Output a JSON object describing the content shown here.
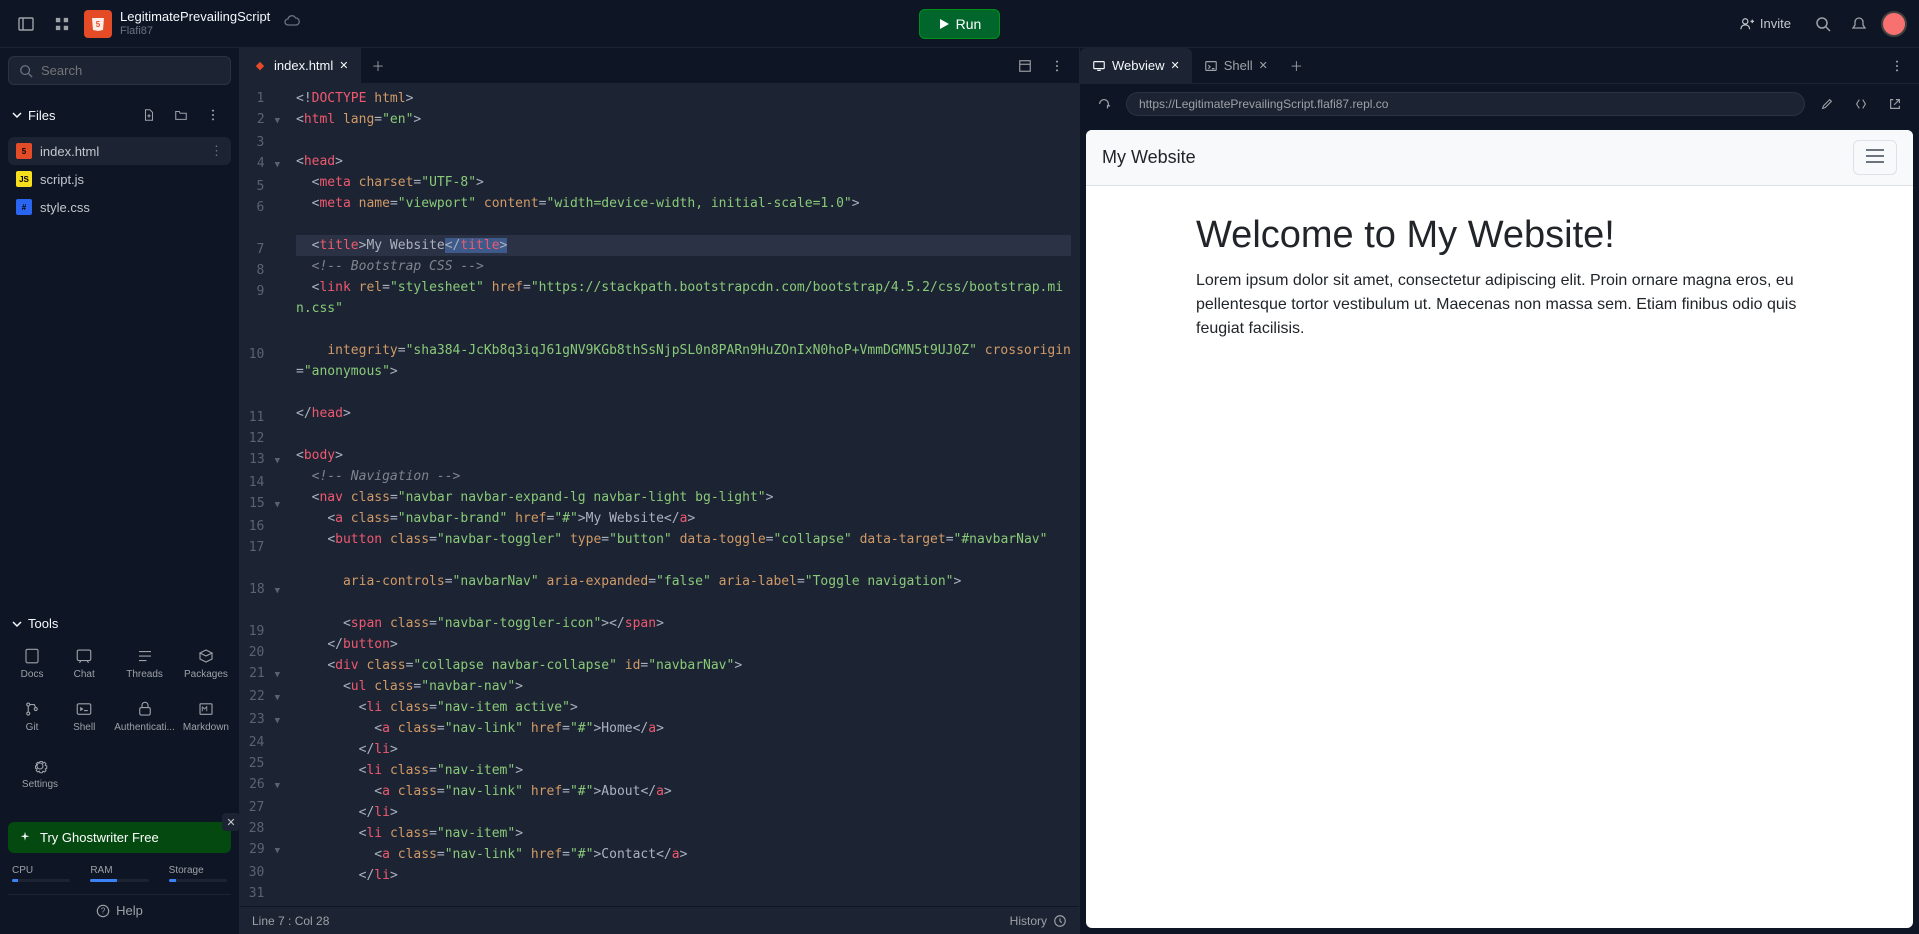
{
  "project": {
    "title": "LegitimatePrevailingScript",
    "owner": "Flafi87"
  },
  "topbar": {
    "run": "Run",
    "invite": "Invite"
  },
  "search": {
    "placeholder": "Search"
  },
  "files": {
    "header": "Files",
    "items": [
      {
        "name": "index.html",
        "type": "html",
        "active": true
      },
      {
        "name": "script.js",
        "type": "js"
      },
      {
        "name": "style.css",
        "type": "css"
      }
    ]
  },
  "tools": {
    "header": "Tools",
    "items": [
      "Docs",
      "Chat",
      "Threads",
      "Packages",
      "Git",
      "Shell",
      "Authenticati...",
      "Markdown"
    ],
    "settings": "Settings"
  },
  "ghostwriter": "Try Ghostwriter Free",
  "stats": {
    "cpu": "CPU",
    "ram": "RAM",
    "storage": "Storage",
    "cpu_pct": 10,
    "ram_pct": 45,
    "storage_pct": 12
  },
  "help": "Help",
  "editor": {
    "tab": "index.html",
    "status_left": "Line 7 : Col 28",
    "status_right": "History"
  },
  "code_lines": [
    {
      "n": 1,
      "html": "<span class='t-punc'>&lt;!</span><span class='t-tag'>DOCTYPE</span> <span class='t-attr'>html</span><span class='t-punc'>&gt;</span>"
    },
    {
      "n": 2,
      "fold": true,
      "html": "<span class='t-punc'>&lt;</span><span class='t-tag'>html</span> <span class='t-attr'>lang</span><span class='t-punc'>=</span><span class='t-str'>\"en\"</span><span class='t-punc'>&gt;</span>"
    },
    {
      "n": 3,
      "html": ""
    },
    {
      "n": 4,
      "fold": true,
      "html": "<span class='t-punc'>&lt;</span><span class='t-tag'>head</span><span class='t-punc'>&gt;</span>"
    },
    {
      "n": 5,
      "html": "  <span class='t-punc'>&lt;</span><span class='t-tag'>meta</span> <span class='t-attr'>charset</span><span class='t-punc'>=</span><span class='t-str'>\"UTF-8\"</span><span class='t-punc'>&gt;</span>"
    },
    {
      "n": 6,
      "html": "  <span class='t-punc'>&lt;</span><span class='t-tag'>meta</span> <span class='t-attr'>name</span><span class='t-punc'>=</span><span class='t-str'>\"viewport\"</span> <span class='t-attr'>content</span><span class='t-punc'>=</span><span class='t-str'>\"width=device-width, initial-scale=1.0\"</span><span class='t-punc'>&gt;</span>"
    },
    {
      "n": 7,
      "hl": true,
      "html": "  <span class='t-punc'>&lt;</span><span class='t-tag'>title</span><span class='t-punc'>&gt;</span><span class='t-text'>My Website</span><span class='sel'><span class='t-punc'>&lt;/</span><span class='t-tag'>title</span><span class='t-punc'>&gt;</span></span>"
    },
    {
      "n": 8,
      "html": "  <span class='t-comment'>&lt;!-- Bootstrap CSS --&gt;</span>"
    },
    {
      "n": 9,
      "html": "  <span class='t-punc'>&lt;</span><span class='t-tag'>link</span> <span class='t-attr'>rel</span><span class='t-punc'>=</span><span class='t-str'>\"stylesheet\"</span> <span class='t-attr'>href</span><span class='t-punc'>=</span><span class='t-str'>\"https://stackpath.bootstrapcdn.com/bootstrap/4.5.2/css/bootstrap.min.css\"</span>"
    },
    {
      "n": 10,
      "html": "    <span class='t-attr'>integrity</span><span class='t-punc'>=</span><span class='t-str'>\"sha384-JcKb8q3iqJ61gNV9KGb8thSsNjpSL0n8PARn9HuZOnIxN0hoP+VmmDGMN5t9UJ0Z\"</span> <span class='t-attr'>crossorigin</span><span class='t-punc'>=</span><span class='t-str'>\"anonymous\"</span><span class='t-punc'>&gt;</span>"
    },
    {
      "n": 11,
      "html": "<span class='t-punc'>&lt;/</span><span class='t-tag'>head</span><span class='t-punc'>&gt;</span>"
    },
    {
      "n": 12,
      "html": ""
    },
    {
      "n": 13,
      "fold": true,
      "html": "<span class='t-punc'>&lt;</span><span class='t-tag'>body</span><span class='t-punc'>&gt;</span>"
    },
    {
      "n": 14,
      "html": "  <span class='t-comment'>&lt;!-- Navigation --&gt;</span>"
    },
    {
      "n": 15,
      "fold": true,
      "html": "  <span class='t-punc'>&lt;</span><span class='t-tag'>nav</span> <span class='t-attr'>class</span><span class='t-punc'>=</span><span class='t-str'>\"navbar navbar-expand-lg navbar-light bg-light\"</span><span class='t-punc'>&gt;</span>"
    },
    {
      "n": 16,
      "html": "    <span class='t-punc'>&lt;</span><span class='t-tag'>a</span> <span class='t-attr'>class</span><span class='t-punc'>=</span><span class='t-str'>\"navbar-brand\"</span> <span class='t-attr'>href</span><span class='t-punc'>=</span><span class='t-str'>\"#\"</span><span class='t-punc'>&gt;</span><span class='t-text'>My Website</span><span class='t-punc'>&lt;/</span><span class='t-tag'>a</span><span class='t-punc'>&gt;</span>"
    },
    {
      "n": 17,
      "html": "    <span class='t-punc'>&lt;</span><span class='t-tag'>button</span> <span class='t-attr'>class</span><span class='t-punc'>=</span><span class='t-str'>\"navbar-toggler\"</span> <span class='t-attr'>type</span><span class='t-punc'>=</span><span class='t-str'>\"button\"</span> <span class='t-attr'>data-toggle</span><span class='t-punc'>=</span><span class='t-str'>\"collapse\"</span> <span class='t-attr'>data-target</span><span class='t-punc'>=</span><span class='t-str'>\"#navbarNav\"</span>"
    },
    {
      "n": 18,
      "fold": true,
      "html": "      <span class='t-attr'>aria-controls</span><span class='t-punc'>=</span><span class='t-str'>\"navbarNav\"</span> <span class='t-attr'>aria-expanded</span><span class='t-punc'>=</span><span class='t-str'>\"false\"</span> <span class='t-attr'>aria-label</span><span class='t-punc'>=</span><span class='t-str'>\"Toggle navigation\"</span><span class='t-punc'>&gt;</span>"
    },
    {
      "n": 19,
      "html": "      <span class='t-punc'>&lt;</span><span class='t-tag'>span</span> <span class='t-attr'>class</span><span class='t-punc'>=</span><span class='t-str'>\"navbar-toggler-icon\"</span><span class='t-punc'>&gt;&lt;/</span><span class='t-tag'>span</span><span class='t-punc'>&gt;</span>"
    },
    {
      "n": 20,
      "html": "    <span class='t-punc'>&lt;/</span><span class='t-tag'>button</span><span class='t-punc'>&gt;</span>"
    },
    {
      "n": 21,
      "fold": true,
      "html": "    <span class='t-punc'>&lt;</span><span class='t-tag'>div</span> <span class='t-attr'>class</span><span class='t-punc'>=</span><span class='t-str'>\"collapse navbar-collapse\"</span> <span class='t-attr'>id</span><span class='t-punc'>=</span><span class='t-str'>\"navbarNav\"</span><span class='t-punc'>&gt;</span>"
    },
    {
      "n": 22,
      "fold": true,
      "html": "      <span class='t-punc'>&lt;</span><span class='t-tag'>ul</span> <span class='t-attr'>class</span><span class='t-punc'>=</span><span class='t-str'>\"navbar-nav\"</span><span class='t-punc'>&gt;</span>"
    },
    {
      "n": 23,
      "fold": true,
      "html": "        <span class='t-punc'>&lt;</span><span class='t-tag'>li</span> <span class='t-attr'>class</span><span class='t-punc'>=</span><span class='t-str'>\"nav-item active\"</span><span class='t-punc'>&gt;</span>"
    },
    {
      "n": 24,
      "html": "          <span class='t-punc'>&lt;</span><span class='t-tag'>a</span> <span class='t-attr'>class</span><span class='t-punc'>=</span><span class='t-str'>\"nav-link\"</span> <span class='t-attr'>href</span><span class='t-punc'>=</span><span class='t-str'>\"#\"</span><span class='t-punc'>&gt;</span><span class='t-text'>Home</span><span class='t-punc'>&lt;/</span><span class='t-tag'>a</span><span class='t-punc'>&gt;</span>"
    },
    {
      "n": 25,
      "html": "        <span class='t-punc'>&lt;/</span><span class='t-tag'>li</span><span class='t-punc'>&gt;</span>"
    },
    {
      "n": 26,
      "fold": true,
      "html": "        <span class='t-punc'>&lt;</span><span class='t-tag'>li</span> <span class='t-attr'>class</span><span class='t-punc'>=</span><span class='t-str'>\"nav-item\"</span><span class='t-punc'>&gt;</span>"
    },
    {
      "n": 27,
      "html": "          <span class='t-punc'>&lt;</span><span class='t-tag'>a</span> <span class='t-attr'>class</span><span class='t-punc'>=</span><span class='t-str'>\"nav-link\"</span> <span class='t-attr'>href</span><span class='t-punc'>=</span><span class='t-str'>\"#\"</span><span class='t-punc'>&gt;</span><span class='t-text'>About</span><span class='t-punc'>&lt;/</span><span class='t-tag'>a</span><span class='t-punc'>&gt;</span>"
    },
    {
      "n": 28,
      "html": "        <span class='t-punc'>&lt;/</span><span class='t-tag'>li</span><span class='t-punc'>&gt;</span>"
    },
    {
      "n": 29,
      "fold": true,
      "html": "        <span class='t-punc'>&lt;</span><span class='t-tag'>li</span> <span class='t-attr'>class</span><span class='t-punc'>=</span><span class='t-str'>\"nav-item\"</span><span class='t-punc'>&gt;</span>"
    },
    {
      "n": 30,
      "html": "          <span class='t-punc'>&lt;</span><span class='t-tag'>a</span> <span class='t-attr'>class</span><span class='t-punc'>=</span><span class='t-str'>\"nav-link\"</span> <span class='t-attr'>href</span><span class='t-punc'>=</span><span class='t-str'>\"#\"</span><span class='t-punc'>&gt;</span><span class='t-text'>Contact</span><span class='t-punc'>&lt;/</span><span class='t-tag'>a</span><span class='t-punc'>&gt;</span>"
    },
    {
      "n": 31,
      "html": "        <span class='t-punc'>&lt;/</span><span class='t-tag'>li</span><span class='t-punc'>&gt;</span>"
    }
  ],
  "preview": {
    "tabs": {
      "webview": "Webview",
      "shell": "Shell"
    },
    "url": "https://LegitimatePrevailingScript.flafi87.repl.co"
  },
  "webview": {
    "brand": "My Website",
    "heading": "Welcome to My Website!",
    "paragraph": "Lorem ipsum dolor sit amet, consectetur adipiscing elit. Proin ornare magna eros, eu pellentesque tortor vestibulum ut. Maecenas non massa sem. Etiam finibus odio quis feugiat facilisis."
  }
}
